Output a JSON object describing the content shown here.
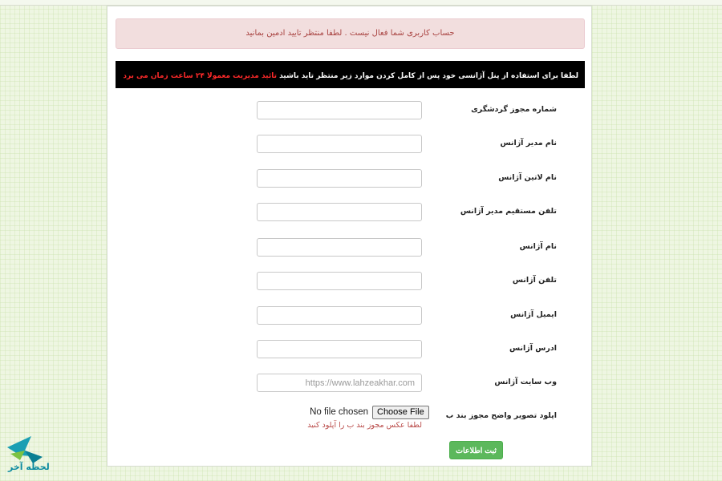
{
  "alert": {
    "text": "حساب کاربری شما فعال نیست . لطفا منتظر تایید ادمین بمانید"
  },
  "notice": {
    "text": "لطفا برای استفاده از پنل آژانسی خود پس از کامل کردن موارد زیر منتظر تاید باشید",
    "highlight": "تائید مدیریت معمولا ۲۴ ساعت زمان می برد"
  },
  "form": {
    "fields": [
      {
        "label": "شماره مجوز گردشگری",
        "value": "",
        "placeholder": ""
      },
      {
        "label": "نام مدیر آژانس",
        "value": "",
        "placeholder": ""
      },
      {
        "label": "نام لاتین آژانس",
        "value": "",
        "placeholder": ""
      },
      {
        "label": "تلفن مستقیم مدیر آژانس",
        "value": "",
        "placeholder": ""
      },
      {
        "label": "نام آژانس",
        "value": "",
        "placeholder": ""
      },
      {
        "label": "تلفن آژانس",
        "value": "",
        "placeholder": ""
      },
      {
        "label": "ایمیل آژانس",
        "value": "",
        "placeholder": ""
      },
      {
        "label": "ادرس آژانس",
        "value": "",
        "placeholder": ""
      },
      {
        "label": "وب سایت آژانس",
        "value": "",
        "placeholder": "https://www.lahzeakhar.com"
      }
    ],
    "upload": {
      "label": "اپلود تصویر واضح مجوز بند ب",
      "button": "Choose File",
      "status": "No file chosen",
      "help": "لطفا عکس مجوز بند ب را آپلود کنید"
    },
    "submit": "ثبت اطلاعات"
  },
  "logo": {
    "text": "لحظه آخر",
    "icon": "plane-logo-icon"
  },
  "colors": {
    "alert_bg": "#f2dede",
    "alert_text": "#a94442",
    "notice_bg": "#000000",
    "highlight": "#ff2a2a",
    "submit_bg": "#5cb85c"
  }
}
